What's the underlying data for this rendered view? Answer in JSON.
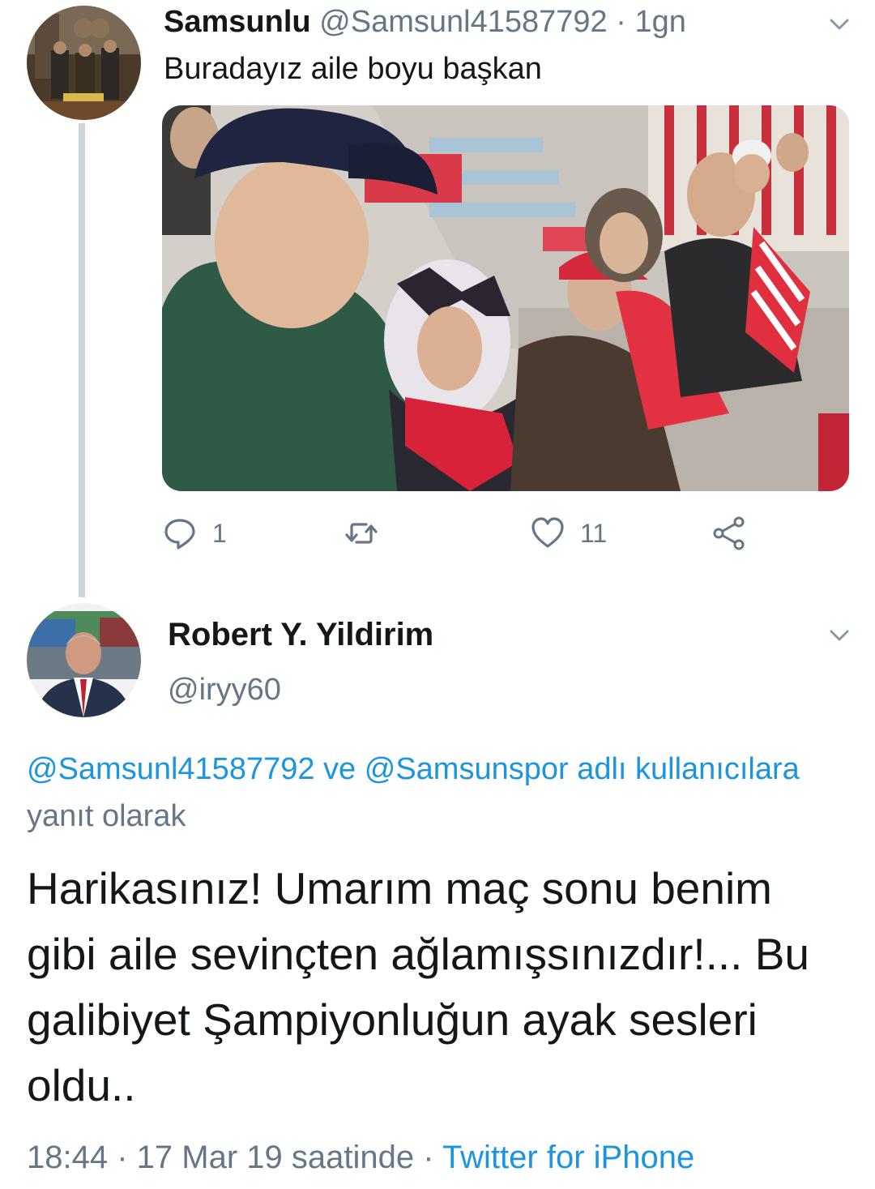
{
  "tweet1": {
    "display_name": "Samsunlu",
    "handle": "@Samsunl41587792",
    "separator": "·",
    "time": "1gn",
    "text": "Buradayız aile boyu başkan",
    "avatar_icon": "user-avatar",
    "media_icon": "stadium-family-photo",
    "actions": {
      "reply_count": "1",
      "retweet_count": "",
      "like_count": "11"
    },
    "icons": {
      "reply": "reply-bubble-icon",
      "retweet": "retweet-icon",
      "like": "heart-icon",
      "share": "share-icon",
      "menu": "chevron-down-icon"
    }
  },
  "tweet2": {
    "display_name": "Robert Y. Yildirim",
    "handle": "@iryy60",
    "replying_mention1": "@Samsunl41587792",
    "replying_and": " ve ",
    "replying_mention2": "@Samsunspor adlı kullanıcılara",
    "replying_suffix": " yanıt olarak",
    "text": "Harikasınız! Umarım maç sonu benim gibi aile sevinçten ağlamışsınızdır!... Bu galibiyet Şampiyonluğun ayak sesleri oldu..",
    "time": "18:44",
    "sep": " · ",
    "date": "17 Mar 19 saatinde",
    "sep2": " · ",
    "source": "Twitter for iPhone"
  },
  "colors": {
    "text": "#14171a",
    "secondary": "#657786",
    "link": "#1b95e0",
    "thread_line": "#cdd6dd"
  }
}
